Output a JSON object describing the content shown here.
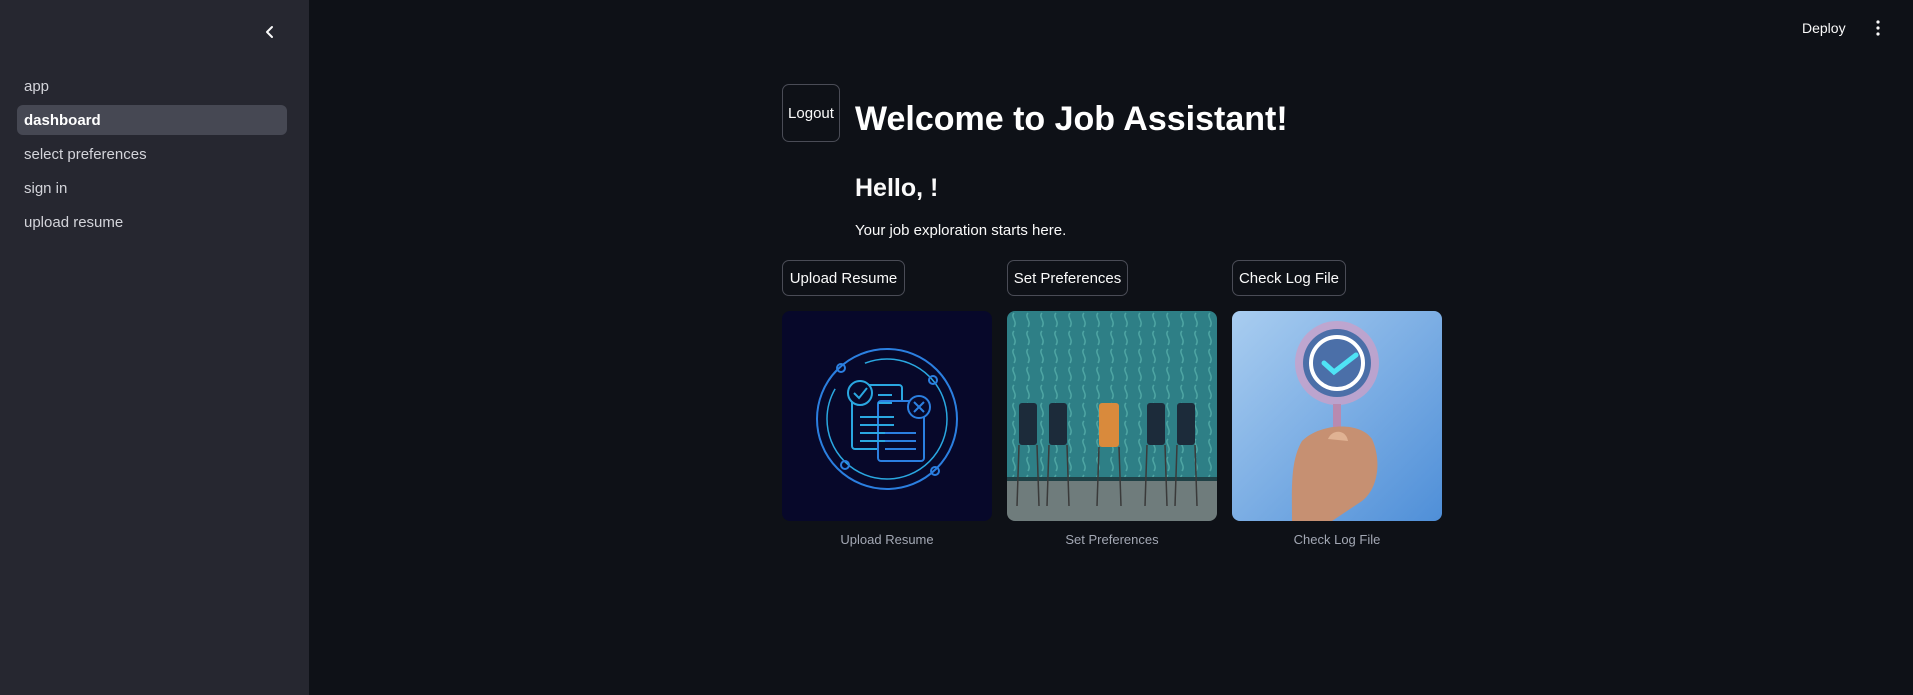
{
  "sidebar": {
    "items": [
      {
        "label": "app",
        "active": false
      },
      {
        "label": "dashboard",
        "active": true
      },
      {
        "label": "select preferences",
        "active": false
      },
      {
        "label": "sign in",
        "active": false
      },
      {
        "label": "upload resume",
        "active": false
      }
    ],
    "collapse_icon": "chevron-left-icon"
  },
  "topbar": {
    "deploy_label": "Deploy",
    "menu_icon": "kebab-menu-icon"
  },
  "main": {
    "logout_label": "Logout",
    "title": "Welcome to Job Assistant!",
    "greeting": "Hello, !",
    "subtext": "Your job exploration starts here.",
    "actions": [
      {
        "button_label": "Upload Resume",
        "caption": "Upload Resume",
        "image": "resume-documents-illustration"
      },
      {
        "button_label": "Set Preferences",
        "caption": "Set Preferences",
        "image": "chairs-row-photo"
      },
      {
        "button_label": "Check Log File",
        "caption": "Check Log File",
        "image": "checkmark-magnifier-photo"
      }
    ]
  },
  "colors": {
    "background": "#0e1117",
    "sidebar": "#262730",
    "active_nav": "#464853",
    "accent_blue": "#2aa7e0"
  }
}
